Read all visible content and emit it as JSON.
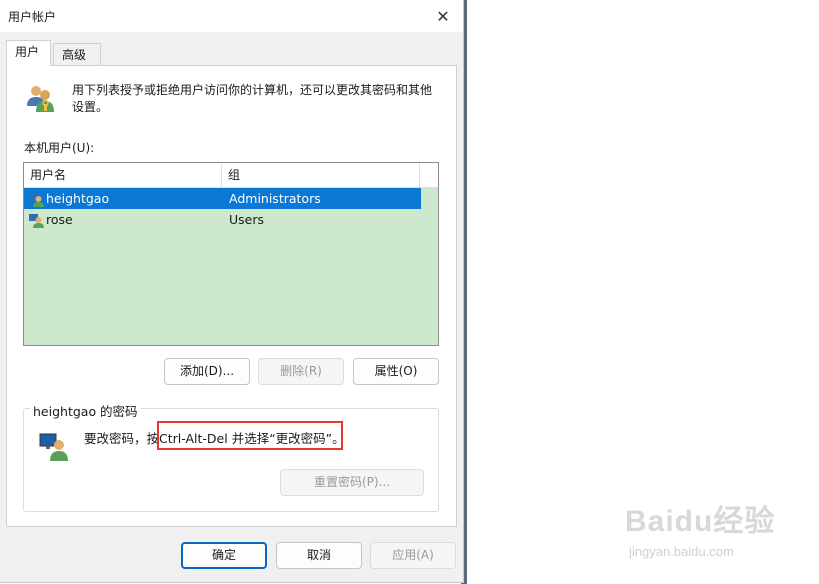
{
  "window": {
    "title": "用户帐户"
  },
  "tabs": [
    {
      "label": "用户"
    },
    {
      "label": "高级"
    }
  ],
  "intro": {
    "text": "用下列表授予或拒绝用户访问你的计算机，还可以更改其密码和其他设置。"
  },
  "users_section": {
    "label": "本机用户(U):",
    "columns": [
      "用户名",
      "组"
    ],
    "rows": [
      {
        "name": "heightgao",
        "group": "Administrators",
        "selected": true
      },
      {
        "name": "rose",
        "group": "Users",
        "selected": false
      }
    ]
  },
  "buttons": {
    "add": "添加(D)...",
    "remove": "删除(R)",
    "properties": "属性(O)",
    "reset_password": "重置密码(P)...",
    "ok": "确定",
    "cancel": "取消",
    "apply": "应用(A)"
  },
  "password_group": {
    "title": "heightgao 的密码",
    "text_prefix": "要改密码，按",
    "text_highlight": "Ctrl-Alt-Del 并选择“更改密码”。"
  },
  "watermark": {
    "logo": "Baidu经验",
    "url": "jingyan.baidu.com"
  },
  "colors": {
    "selection": "#0a78d4",
    "list_bg": "#cde8cd",
    "highlight": "#e53935"
  }
}
